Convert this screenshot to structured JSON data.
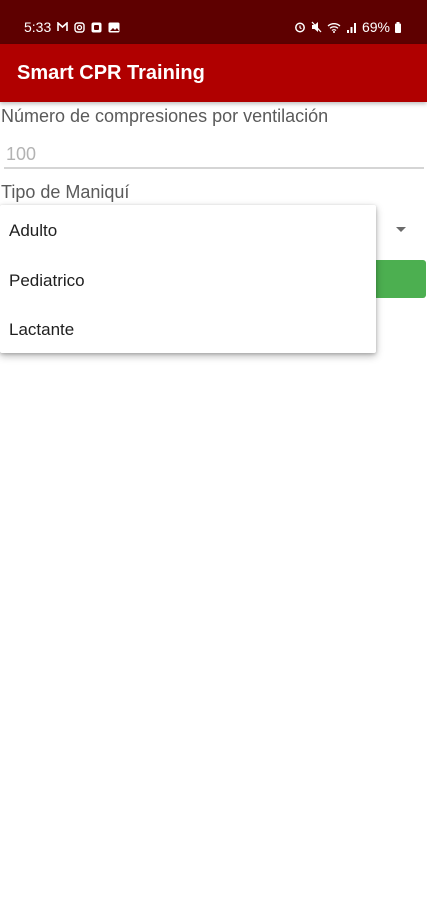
{
  "status_bar": {
    "time": "5:33",
    "battery": "69%",
    "icons_left": [
      "gmail-icon",
      "instagram-icon",
      "notification-icon",
      "gallery-icon"
    ],
    "icons_right": [
      "alarm-icon",
      "mute-icon",
      "wifi-icon",
      "signal-icon",
      "battery-icon"
    ],
    "background_color": "#5e0000"
  },
  "app_bar": {
    "title": "Smart CPR Training",
    "background_color": "#b00000"
  },
  "form": {
    "compressions": {
      "label": "Número de compresiones por ventilación",
      "placeholder": "100"
    },
    "manikin": {
      "label": "Tipo de Maniquí"
    }
  },
  "dropdown": {
    "options": [
      "Adulto",
      "Pediatrico",
      "Lactante"
    ]
  },
  "button": {
    "color": "#4caf50"
  }
}
